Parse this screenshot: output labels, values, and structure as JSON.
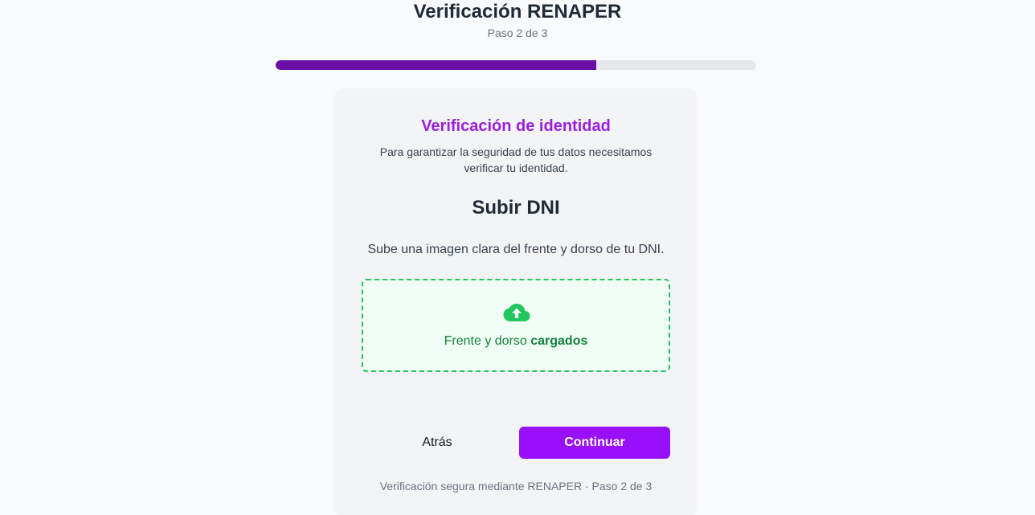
{
  "header": {
    "title": "Verificación RENAPER",
    "step": "Paso 2 de 3",
    "progress": 0.667
  },
  "card": {
    "title": "Verificación de identidad",
    "description": "Para garantizar la seguridad de tus datos necesitamos verificar tu identidad.",
    "section_title": "Subir DNI",
    "section_description": "Sube una imagen clara del frente y dorso de tu DNI.",
    "upload": {
      "icon": "cloud-upload-icon",
      "text_prefix": "Frente y dorso ",
      "text_status": "cargados"
    },
    "back_label": "Atrás",
    "continue_label": "Continuar",
    "footer": "Verificación segura mediante RENAPER · Paso 2 de 3"
  },
  "colors": {
    "progress": "#6b0ea6",
    "accent": "#9810fa",
    "title_accent": "#9b1ee0",
    "success": "#22c55e",
    "success_text": "#15803d"
  }
}
